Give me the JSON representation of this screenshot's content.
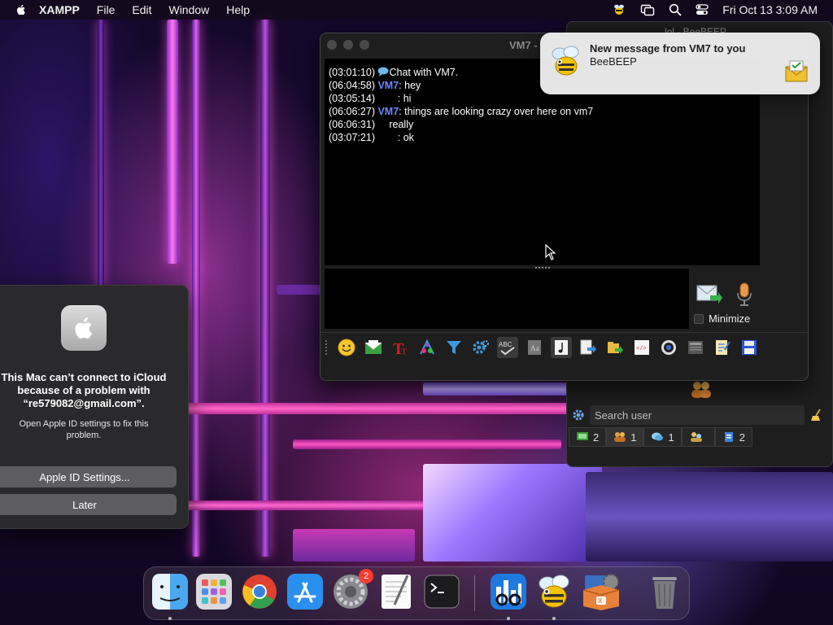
{
  "menubar": {
    "app_name": "XAMPP",
    "menus": [
      "File",
      "Edit",
      "Window",
      "Help"
    ],
    "clock": "Fri Oct 13  3:09 AM",
    "status_icons": [
      "beebeep-icon",
      "screen-mirroring-icon",
      "spotlight-search-icon",
      "control-center-icon"
    ]
  },
  "icloud_dialog": {
    "title": "This Mac can’t connect to iCloud because of a problem with “re579082@gmail.com”.",
    "body": "Open Apple ID settings to fix this problem.",
    "primary_button": "Apple ID Settings...",
    "secondary_button": "Later"
  },
  "beebeep_main": {
    "title": "lol - BeeBEEP",
    "search_placeholder": "Search user",
    "tabs": [
      {
        "icon": "users-online-icon",
        "count": "2"
      },
      {
        "icon": "groups-icon",
        "count": "1"
      },
      {
        "icon": "chats-icon",
        "count": "1"
      },
      {
        "icon": "group-chat-icon",
        "count": ""
      },
      {
        "icon": "files-icon",
        "count": "2"
      }
    ]
  },
  "chat": {
    "window_title": "VM7 -",
    "messages": [
      {
        "time": "(03:01:10)",
        "nick": "",
        "text": "Chat with VM7.",
        "system": true
      },
      {
        "time": "(06:04:58)",
        "nick": "VM7",
        "text": ": hey"
      },
      {
        "time": "(03:05:14)",
        "nick": "",
        "text": "       : hi"
      },
      {
        "time": "(06:06:27)",
        "nick": "VM7",
        "text": ": things are looking crazy over here on vm7"
      },
      {
        "time": "(06:06:31)",
        "nick": "",
        "text": "    really"
      },
      {
        "time": "(03:07:21)",
        "nick": "",
        "text": "       : ok"
      }
    ],
    "minimize_label": "Minimize",
    "toolbar_icons": [
      "emoticon-icon",
      "message-icon",
      "font-icon",
      "color-icon",
      "filter-icon",
      "settings-icon",
      "spellcheck-icon",
      "dictionary-icon",
      "music-note-icon",
      "send-file-icon",
      "folder-share-icon",
      "html-code-icon",
      "screenshot-icon",
      "history-icon",
      "notes-icon",
      "save-chat-icon"
    ]
  },
  "notification": {
    "title": "New message from VM7 to you",
    "subtitle": "BeeBEEP"
  },
  "dock": {
    "apps": [
      "finder",
      "launchpad",
      "chrome",
      "app-store",
      "system-settings",
      "textedit",
      "terminal",
      "activity-monitor",
      "beebeep",
      "xampp",
      "trash"
    ],
    "settings_badge": "2"
  },
  "colors": {
    "nick": "#6e86ff",
    "badge": "#ff3b30",
    "notification_bg": "#ececec"
  }
}
